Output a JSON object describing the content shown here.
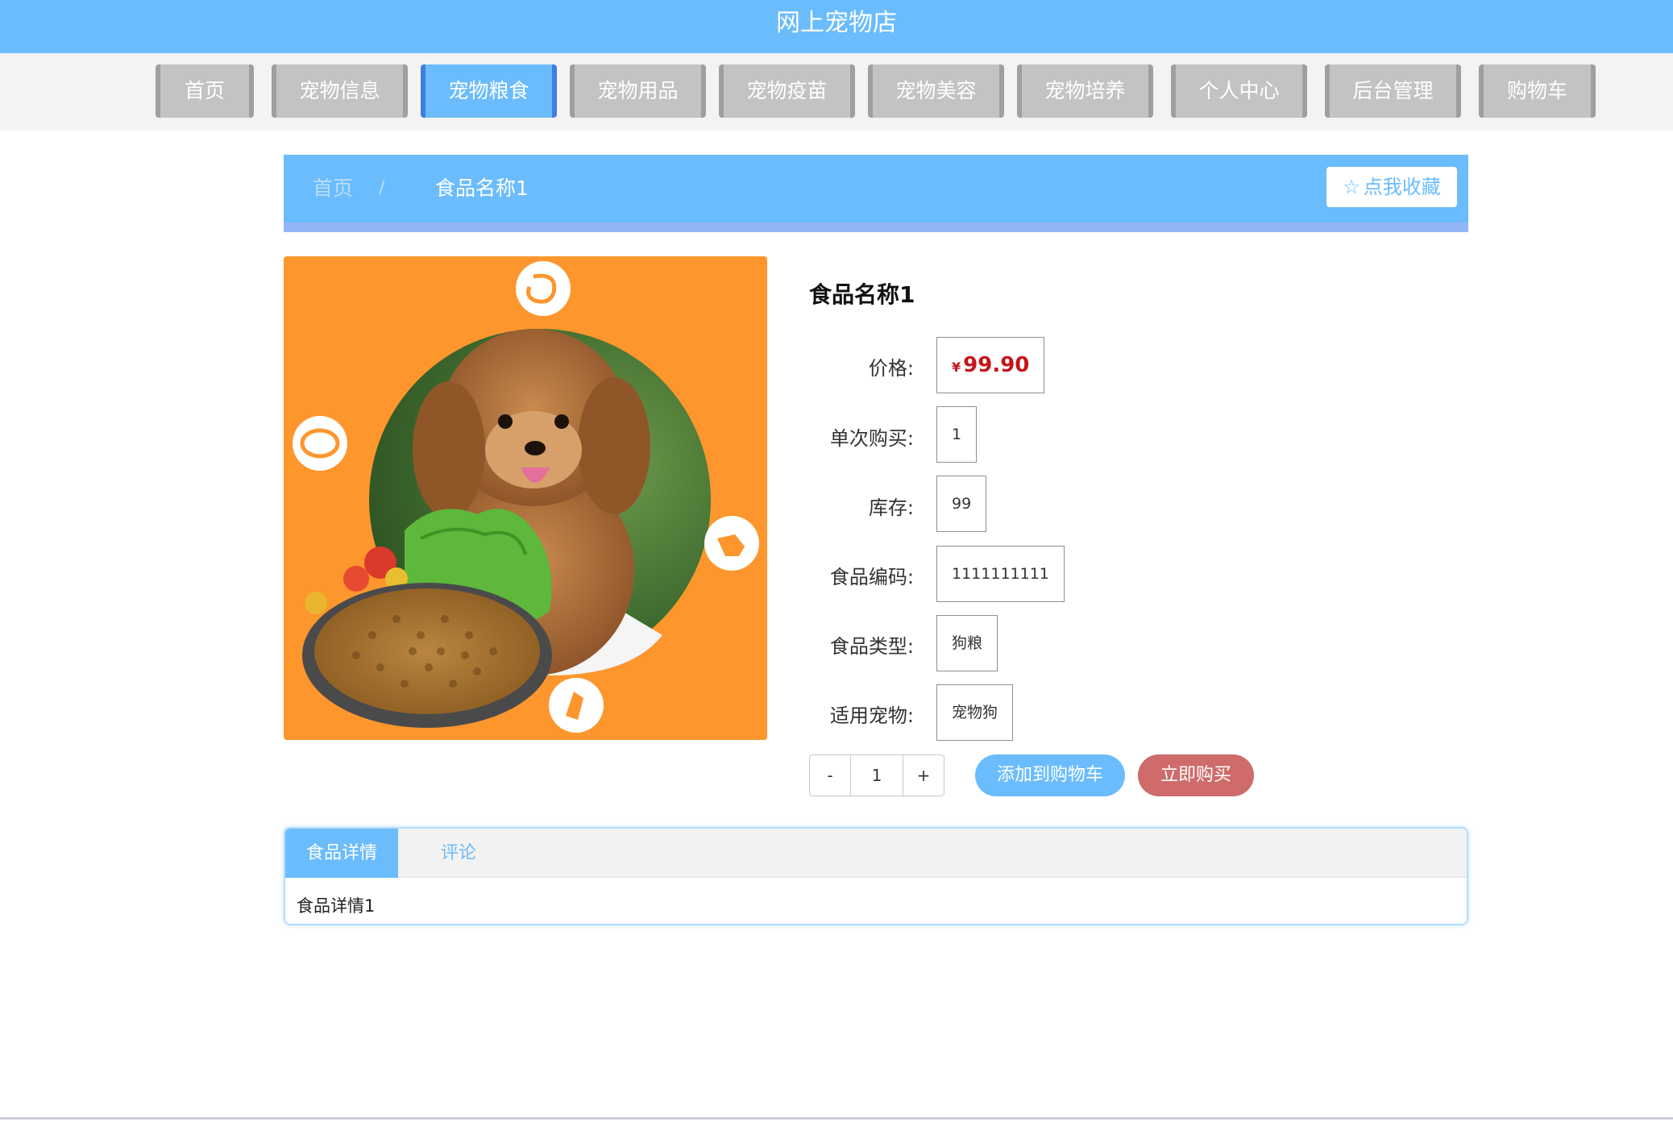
{
  "header": {
    "title": "网上宠物店"
  },
  "nav": {
    "items": [
      {
        "label": "首页"
      },
      {
        "label": "宠物信息"
      },
      {
        "label": "宠物粮食"
      },
      {
        "label": "宠物用品"
      },
      {
        "label": "宠物疫苗"
      },
      {
        "label": "宠物美容"
      },
      {
        "label": "宠物培养"
      },
      {
        "label": "个人中心"
      },
      {
        "label": "后台管理"
      },
      {
        "label": "购物车"
      }
    ],
    "active": "宠物粮食"
  },
  "breadcrumb": {
    "home": "首页",
    "separator": "/",
    "current": "食品名称1",
    "favorite_label": "点我收藏",
    "favorite_icon": "star-outline-icon"
  },
  "product": {
    "image_alt": "dog food with poodle",
    "name": "食品名称1",
    "fields": {
      "price_label": "价格:",
      "currency": "¥",
      "price": "99.90",
      "single_purchase_label": "单次购买:",
      "single_purchase": "1",
      "stock_label": "库存:",
      "stock": "99",
      "code_label": "食品编码:",
      "code": "1111111111",
      "type_label": "食品类型:",
      "type": "狗粮",
      "pet_label": "适用宠物:",
      "pet": "宠物狗"
    },
    "quantity": {
      "minus": "-",
      "value": "1",
      "plus": "+"
    },
    "add_to_cart": "添加到购物车",
    "buy_now": "立即购买"
  },
  "tabs": {
    "items": [
      {
        "label": "食品详情"
      },
      {
        "label": "评论"
      }
    ],
    "content": "食品详情1"
  },
  "colors": {
    "primary": "#6bbcfd",
    "nav_inactive": "#c3c3c3",
    "price": "#c6141a",
    "buy_now": "#cf6b6b",
    "image_bg": "#fd962d"
  }
}
